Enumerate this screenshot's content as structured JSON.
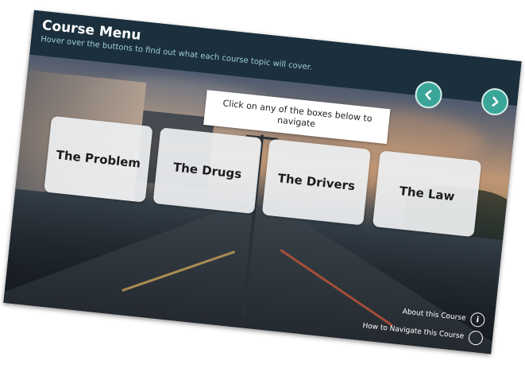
{
  "header": {
    "title": "Course Menu",
    "subtitle": "Hover over the buttons to find out what each course topic will cover."
  },
  "navigation": {
    "prev_icon": "chevron-left-icon",
    "next_icon": "chevron-right-icon",
    "accent_color": "#3aa69a"
  },
  "instruction": "Click on any of the boxes below to navigate",
  "topics": [
    {
      "label": "The Problem"
    },
    {
      "label": "The Drugs"
    },
    {
      "label": "The Drivers"
    },
    {
      "label": "The Law"
    }
  ],
  "footer": {
    "about_label": "About this Course",
    "about_icon": "info-icon",
    "navigate_label": "How to Navigate this Course",
    "navigate_icon": "compass-icon"
  }
}
